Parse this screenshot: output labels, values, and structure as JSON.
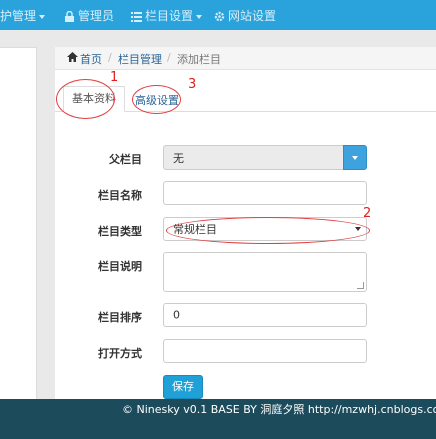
{
  "topbar": {
    "item1": "护管理",
    "item2": "管理员",
    "item3": "栏目设置",
    "item4": "网站设置"
  },
  "breadcrumb": {
    "home": "首页",
    "sep": "/",
    "section": "栏目管理",
    "current": "添加栏目"
  },
  "tabs": {
    "basic": "基本资料",
    "advanced": "高级设置"
  },
  "form": {
    "parent_label": "父栏目",
    "parent_value": "无",
    "name_label": "栏目名称",
    "name_value": "",
    "type_label": "栏目类型",
    "type_value": "常规栏目",
    "desc_label": "栏目说明",
    "desc_value": "",
    "order_label": "栏目排序",
    "order_value": "0",
    "open_label": "打开方式",
    "open_value": "",
    "save_label": "保存"
  },
  "annotations": {
    "a1": "1",
    "a2": "2",
    "a3": "3"
  },
  "footer": {
    "text": "© Ninesky v0.1 BASE BY 洞庭夕照 http://mzwhj.cnblogs.com"
  },
  "colors": {
    "topbar": "#2aa3dc",
    "primary": "#1fa0d6",
    "footer": "#1c4b5c",
    "annotation": "#e02020"
  }
}
